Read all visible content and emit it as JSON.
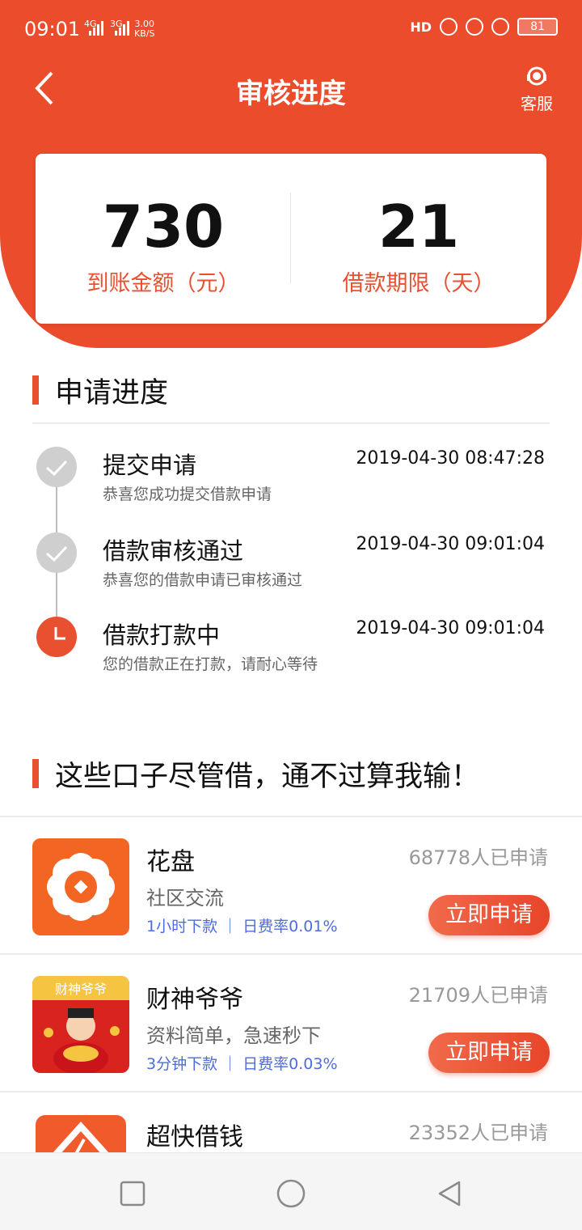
{
  "status_bar": {
    "time": "09:01",
    "net_1": "4G",
    "net_2": "3G",
    "speed_value": "3.00",
    "speed_unit": "KB/S",
    "hd": "HD",
    "battery": "81"
  },
  "header": {
    "title": "审核进度",
    "service_label": "客服"
  },
  "summary": {
    "amount": {
      "value": "730",
      "label": "到账金额（元）"
    },
    "term": {
      "value": "21",
      "label": "借款期限（天）"
    }
  },
  "progress": {
    "title": "申请进度",
    "steps": [
      {
        "title": "提交申请",
        "desc": "恭喜您成功提交借款申请",
        "time": "2019-04-30 08:47:28",
        "state": "done"
      },
      {
        "title": "借款审核通过",
        "desc": "恭喜您的借款申请已审核通过",
        "time": "2019-04-30 09:01:04",
        "state": "done"
      },
      {
        "title": "借款打款中",
        "desc": "您的借款正在打款，请耐心等待",
        "time": "2019-04-30 09:01:04",
        "state": "current"
      }
    ]
  },
  "recommend": {
    "title": "这些口子尽管借，通不过算我输！",
    "products": [
      {
        "name": "花盘",
        "desc": "社区交流",
        "tags": "1小时下款 ｜ 日费率0.01%",
        "count": "68778人已申请",
        "button": "立即申请"
      },
      {
        "name": "财神爷爷",
        "desc": "资料简单，急速秒下",
        "tags": "3分钟下款 ｜ 日费率0.03%",
        "count": "21709人已申请",
        "button": "立即申请",
        "icon_text": "财神爷爷"
      },
      {
        "name": "超快借钱",
        "count": "23352人已申请"
      }
    ]
  },
  "colors": {
    "brand": "#ea4c2c",
    "accent": "#e8502f",
    "tag": "#4e6be0"
  }
}
